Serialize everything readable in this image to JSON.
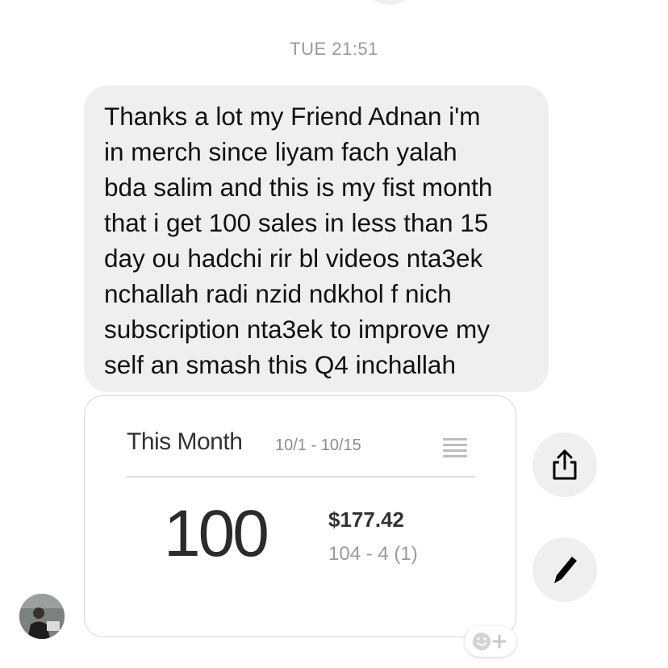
{
  "thread": {
    "timestamp": "TUE 21:51"
  },
  "message": {
    "text": "Thanks a lot my Friend Adnan i'm\nin merch since liyam fach yalah\nbda salim and this is my fist month\nthat i get 100 sales in less than 15\nday ou hadchi rir bl videos nta3ek\nnchallah radi nzid ndkhol f nich\nsubscription nta3ek to improve my\nself an smash this Q4 inchallah"
  },
  "attachment": {
    "title": "This Month",
    "date_range": "10/1 - 10/15",
    "count": "100",
    "amount": "$177.42",
    "detail": "104 - 4 (1)"
  },
  "icons": {
    "share": "share-icon",
    "edit": "pencil-icon",
    "reaction": "emoji-add-icon",
    "menu": "list-menu-icon"
  },
  "colors": {
    "bubble": "#efefef",
    "text": "#111111",
    "timestamp": "#9a9a9a"
  }
}
